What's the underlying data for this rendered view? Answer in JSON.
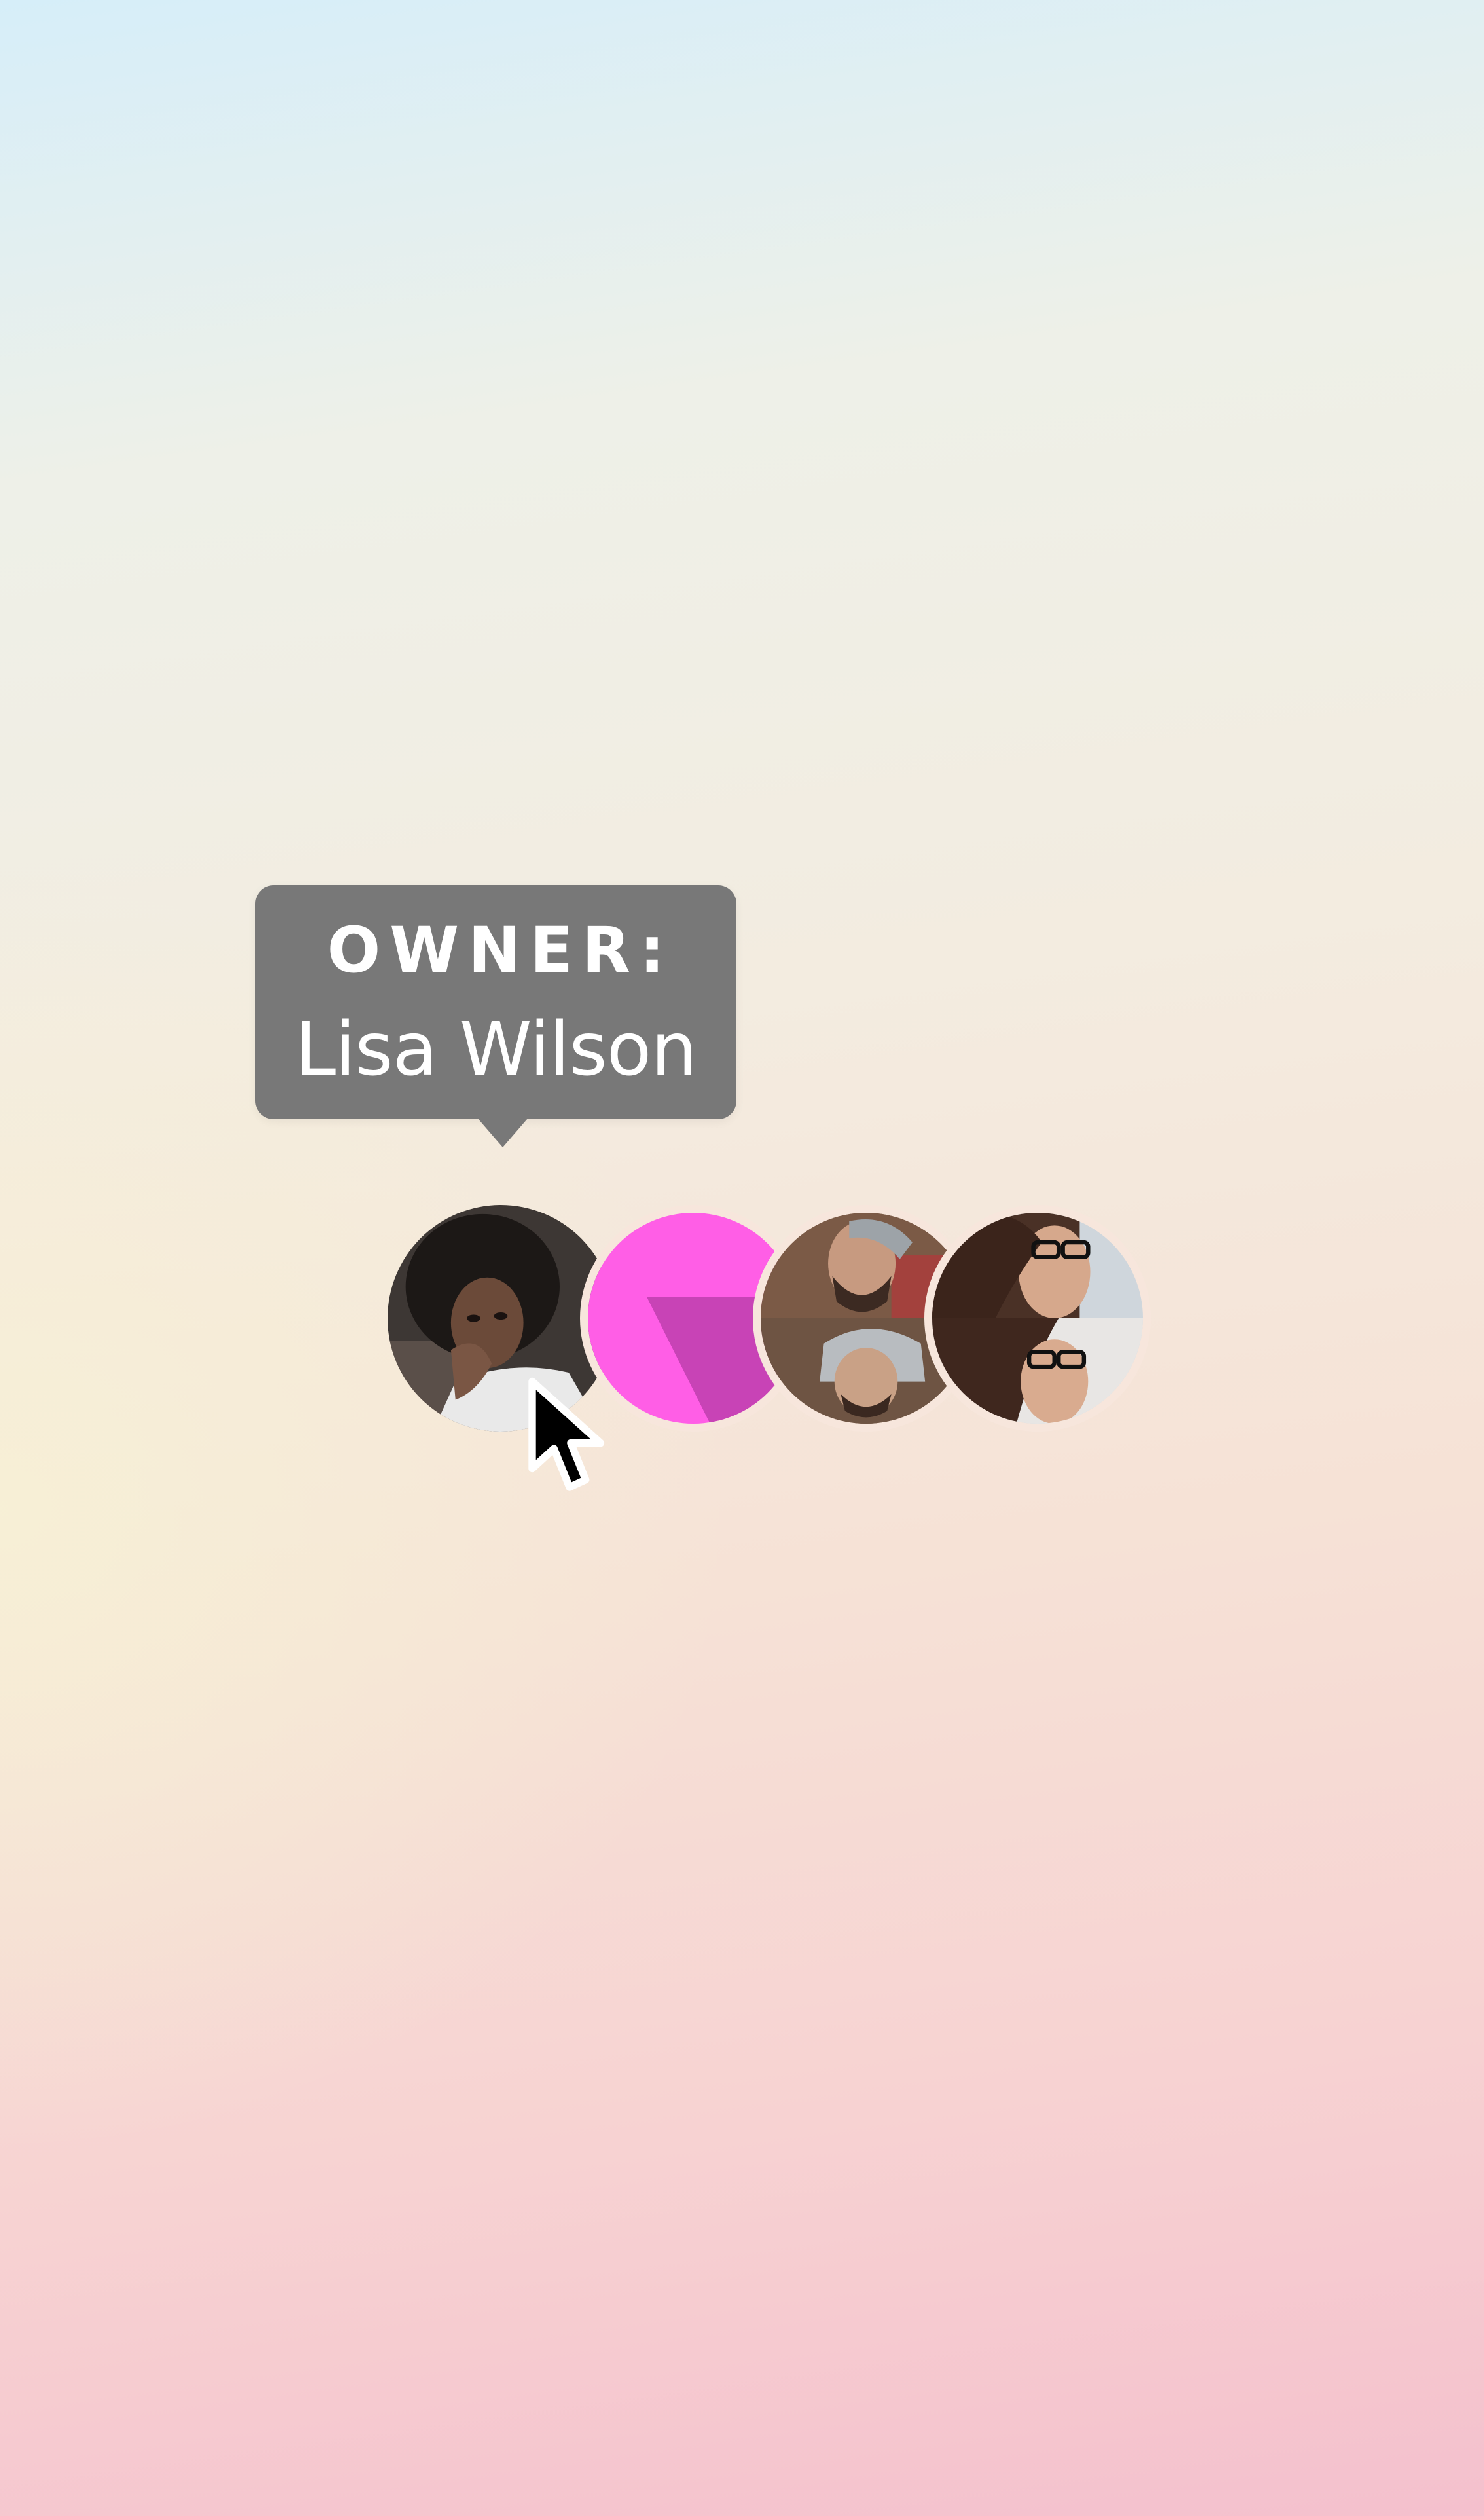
{
  "tooltip": {
    "label": "OWNER:",
    "name": "Lisa Wilson"
  },
  "avatars": [
    {
      "role": "owner",
      "kind": "photo"
    },
    {
      "role": "brand",
      "kind": "logo",
      "color": "#ff5ee6",
      "accent": "#c843b6"
    },
    {
      "role": "member-group",
      "kind": "photo-pair"
    },
    {
      "role": "member-group",
      "kind": "photo-pair"
    }
  ],
  "cursor": {
    "icon": "arrow-pointer-icon"
  },
  "colors": {
    "tooltip_bg": "#787878",
    "tooltip_text": "#ffffff",
    "brand_magenta": "#ff5ee6",
    "brand_magenta_dark": "#c843b6"
  }
}
